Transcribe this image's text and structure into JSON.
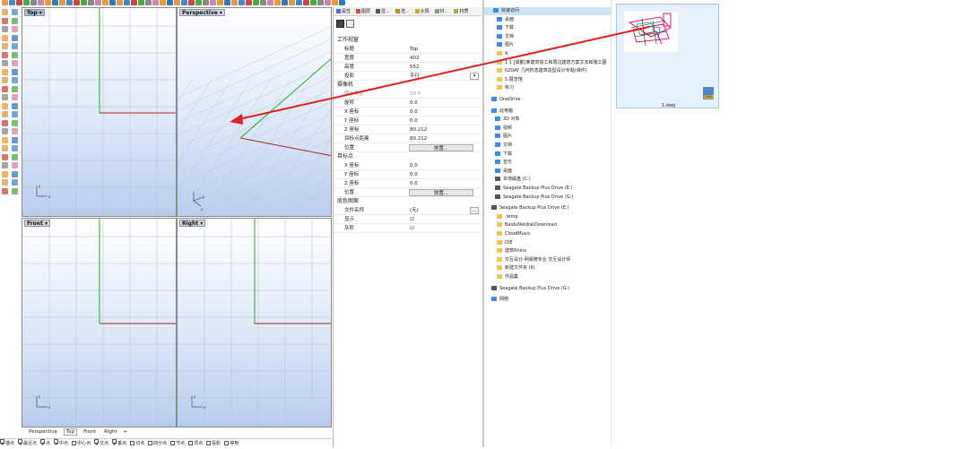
{
  "viewports": {
    "top": {
      "title": "Top"
    },
    "perspective": {
      "title": "Perspective"
    },
    "front": {
      "title": "Front"
    },
    "right": {
      "title": "Right"
    },
    "axis_x": "x",
    "axis_y": "y"
  },
  "viewport_tabs": [
    "Perspective",
    "Top",
    "Front",
    "Right"
  ],
  "add_tab": "+",
  "osnap": [
    "端点",
    "最近点",
    "点",
    "中点",
    "中心点",
    "交点",
    "垂点",
    "切点",
    "四分点",
    "节点",
    "顶点",
    "投影"
  ],
  "osnap_checked": [
    true,
    true,
    true,
    true,
    false,
    true,
    true,
    false,
    false,
    false,
    false,
    false
  ],
  "osnap_disable": "停用",
  "panel": {
    "tabs": [
      "属性",
      "图层",
      "显...",
      "渲...",
      "太阳",
      "材...",
      "材质"
    ],
    "sections": {
      "viewport": "工作视窗",
      "camera": "摄像机",
      "target": "目标点",
      "background": "底色图案"
    },
    "viewport_rows": [
      {
        "k": "标题",
        "v": "Top"
      },
      {
        "k": "宽度",
        "v": "402"
      },
      {
        "k": "高度",
        "v": "552"
      },
      {
        "k": "投影",
        "v": "平行"
      }
    ],
    "camera_rows": [
      {
        "k": "镜头焦距",
        "v": "50.0"
      },
      {
        "k": "旋转",
        "v": "0.0"
      },
      {
        "k": "X 座标",
        "v": "0.0"
      },
      {
        "k": "Y 座标",
        "v": "0.0"
      },
      {
        "k": "Z 座标",
        "v": "80.212"
      },
      {
        "k": "目标点距离",
        "v": "80.212"
      },
      {
        "k": "位置",
        "v": "放置..."
      }
    ],
    "target_rows": [
      {
        "k": "X 座标",
        "v": "0.0"
      },
      {
        "k": "Y 座标",
        "v": "0.0"
      },
      {
        "k": "Z 座标",
        "v": "0.0"
      },
      {
        "k": "位置",
        "v": "放置..."
      }
    ],
    "background_rows": [
      {
        "k": "文件名称",
        "v": "(无)"
      },
      {
        "k": "显示",
        "v": "☑"
      },
      {
        "k": "灰阶",
        "v": "☑"
      }
    ],
    "browse_label": "..."
  },
  "explorer": {
    "quick_access": "快速访问",
    "quick_items": [
      "桌面",
      "下载",
      "文档",
      "图片",
      "A",
      "1.1 [成都]某建筑竣工和周边建筑方案文本和施工图",
      "02DAY 几何形态建筑造型设计专题(课件)",
      "5.展览馆",
      "练习"
    ],
    "onedrive": "OneDrive",
    "this_pc": "此电脑",
    "pc_items": [
      "3D 对象",
      "视频",
      "图片",
      "文档",
      "下载",
      "音乐",
      "桌面",
      "本地磁盘 (C:)",
      "Seagate Backup Plus Drive (E:)",
      "Seagate Backup Plus Drive (G:)"
    ],
    "drive_e": "Seagate Backup Plus Drive (E:)",
    "e_items": [
      ".temp",
      "BaiduNetdiskDownload",
      "CloudMusic",
      "IDE",
      "建筑Rhino",
      "交互设计-网易微专业 交互设计师",
      "新建文件夹 (6)",
      "作品集"
    ],
    "drive_g": "Seagate Backup Plus Drive (G:)",
    "network": "网络"
  },
  "file": {
    "name": "1.dwg",
    "badge": "DWG"
  },
  "colors": {
    "accent": "#e02020",
    "axis_green": "#22aa22",
    "axis_red": "#aa2222"
  }
}
